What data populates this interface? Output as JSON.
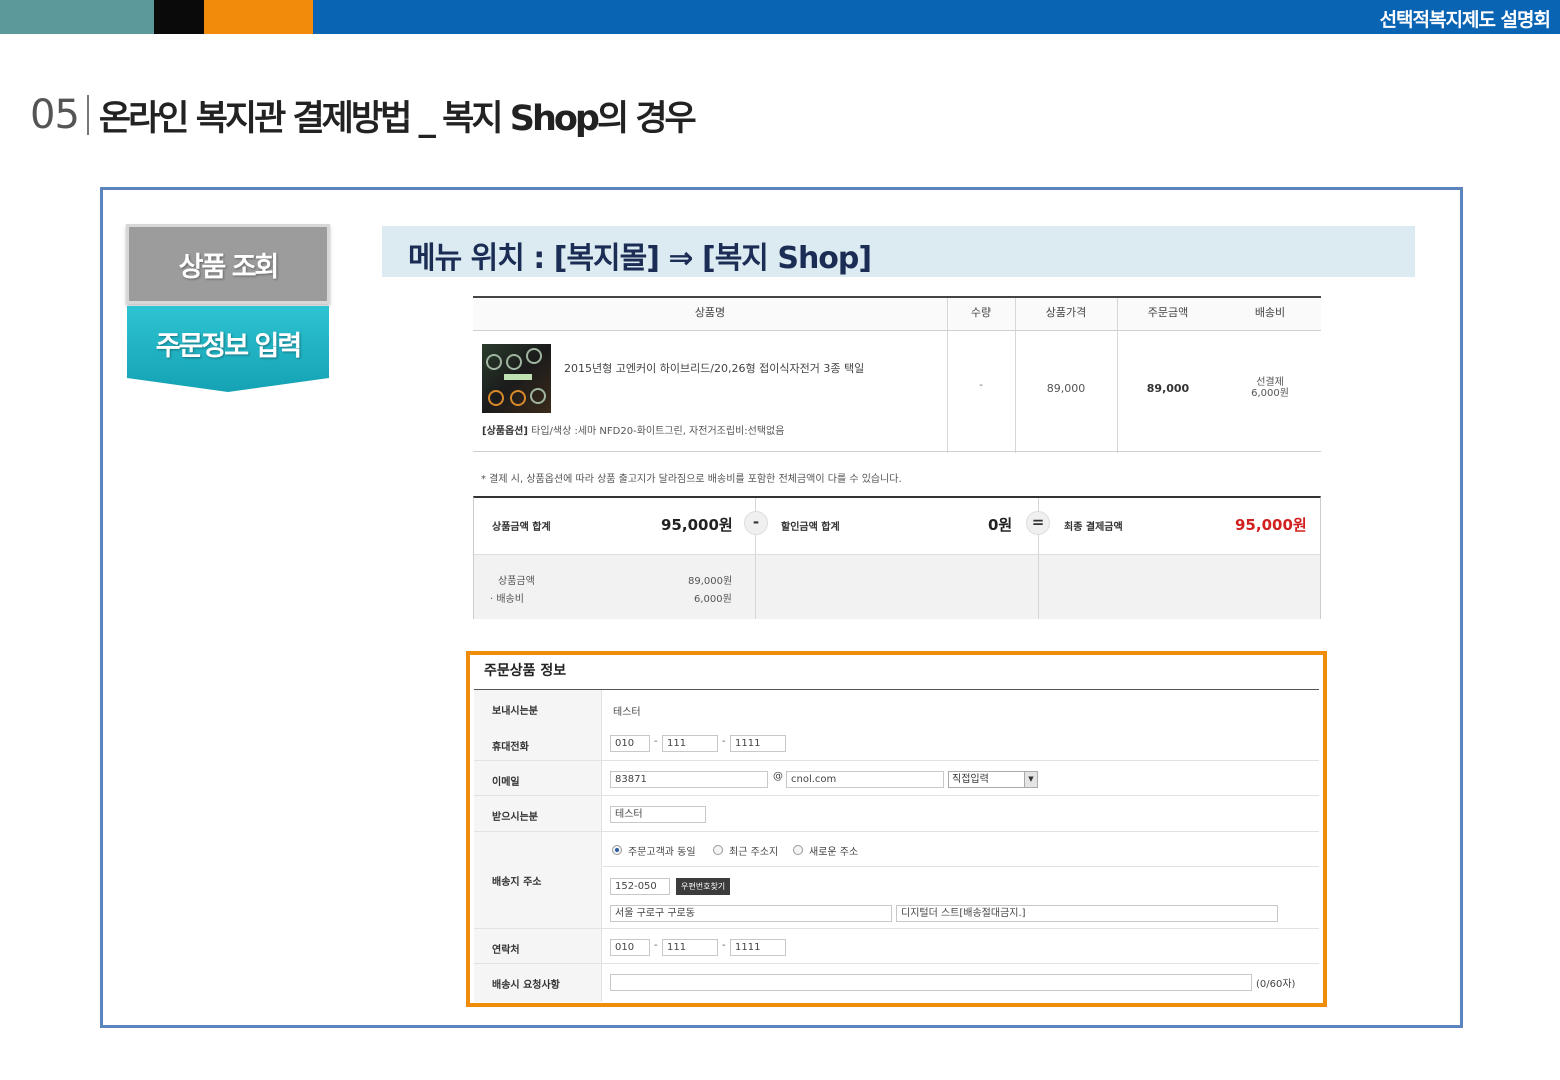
{
  "header": {
    "brand": "선택적복지제도 설명회",
    "colors": {
      "teal": "#5b9a9a",
      "black": "#0a0a0a",
      "orange": "#f28a0c",
      "blue": "#0a64b4"
    }
  },
  "slide": {
    "number": "05",
    "title": "온라인 복지관 결제방법 _ 복지 Shop의 경우"
  },
  "steps": {
    "step1": "상품 조회",
    "step2": "주문정보 입력"
  },
  "menu_location": "메뉴 위치 : [복지몰] ⇒ [복지 Shop]",
  "product_table": {
    "headers": [
      "상품명",
      "수량",
      "상품가격",
      "주문금액",
      "배송비"
    ],
    "item": {
      "name": "2015년형 고엔커이 하이브리드/20,26형 접이식자전거 3종 택일",
      "option_label": "[상품옵션]",
      "option_value": "타입/색상 :세마 NFD20-화이트그린, 자전거조립비:선택없음",
      "qty": "-",
      "price": "89,000",
      "order_amount": "89,000",
      "shipping_line1": "선결제",
      "shipping_line2": "6,000원"
    }
  },
  "note": "* 결제 시, 상품옵션에 따라 상품 출고지가 달라짐으로 배송비를 포함한 전체금액이 다를 수 있습니다.",
  "totals": {
    "product_total_label": "상품금액 합계",
    "product_total_value": "95,000원",
    "minus": "-",
    "discount_label": "할인금액 합계",
    "discount_value": "0원",
    "equals": "=",
    "final_label": "최종 결제금액",
    "final_value": "95,000원",
    "final_color": "#d21f1f",
    "breakdown": [
      {
        "label": "상품금액",
        "value": "89,000원"
      },
      {
        "label": "· 배송비",
        "value": "6,000원"
      }
    ]
  },
  "order_info": {
    "title": "주문상품 정보",
    "sender_label": "보내시는분",
    "sender_value": "테스터",
    "mobile_label": "휴대전화",
    "mobile": [
      "010",
      "111",
      "1111"
    ],
    "email_label": "이메일",
    "email_id": "83871",
    "email_at": "@",
    "email_domain": "cnol.com",
    "email_select": "직접입력",
    "receiver_label": "받으시는분",
    "receiver_value": "테스터",
    "address_label": "배송지 주소",
    "address_options": [
      "주문고객과 동일",
      "최근 주소지",
      "새로운 주소"
    ],
    "zipcode": "152-050",
    "zip_button": "우편번호찾기",
    "address1": "서울 구로구 구로동",
    "address2": "디지털더 스트[배송절대금지.]",
    "contact_label": "연락처",
    "contact": [
      "010",
      "111",
      "1111"
    ],
    "request_label": "배송시 요청사항",
    "request_counter": "(0/60자)"
  }
}
